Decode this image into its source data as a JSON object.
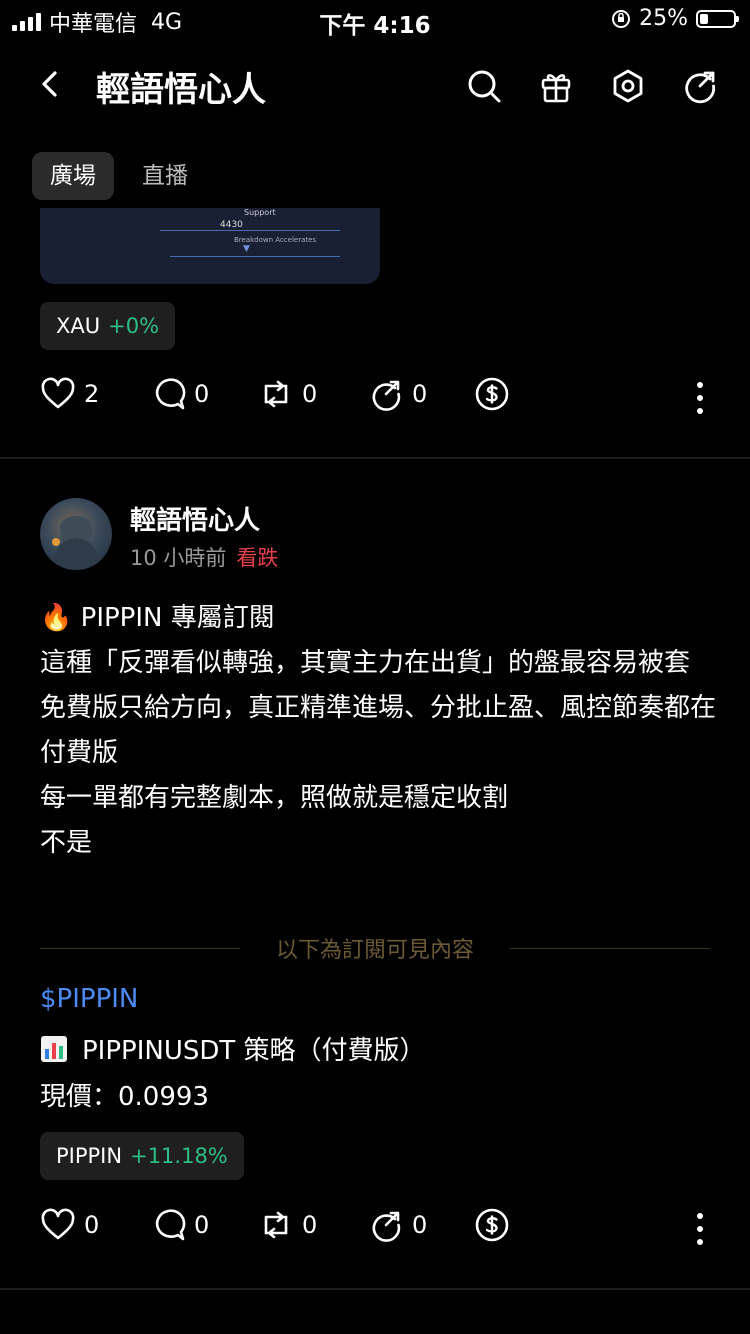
{
  "status_bar": {
    "carrier": "中華電信",
    "network": "4G",
    "time": "下午 4:16",
    "battery_percent": "25%",
    "battery_level": 0.25
  },
  "header": {
    "back_icon": "chevron-left-icon",
    "title": "輕語悟心人",
    "icons": [
      "search-icon",
      "gift-icon",
      "settings-hex-icon",
      "share-icon"
    ]
  },
  "tabs": [
    {
      "label": "廣場",
      "active": true
    },
    {
      "label": "直播",
      "active": false
    }
  ],
  "post1": {
    "image": {
      "label_support": "Support",
      "value": "4430",
      "label_breakdown": "Breakdown Accelerates"
    },
    "tag": {
      "symbol": "XAU",
      "change": "+0%"
    },
    "actions": {
      "likes": "2",
      "comments": "0",
      "reposts": "0",
      "quotes": "0"
    }
  },
  "post2": {
    "author": "輕語悟心人",
    "time_ago": "10 小時前",
    "sentiment": "看跌",
    "body_lines": [
      "🔥 PIPPIN 專屬訂閱",
      "這種「反彈看似轉強，其實主力在出貨」的盤最容易被套",
      "免費版只給方向，真正精準進場、分批止盈、風控節奏都在付費版",
      "每一單都有完整劇本，照做就是穩定收割",
      "不是"
    ],
    "paywall_text": "以下為訂閱可見內容",
    "ticker": "$PIPPIN",
    "strategy_icon": "bar-chart-icon",
    "strategy_title": "PIPPINUSDT 策略（付費版）",
    "price_line": "現價：0.0993",
    "tag": {
      "symbol": "PIPPIN",
      "change": "+11.18%"
    },
    "actions": {
      "likes": "0",
      "comments": "0",
      "reposts": "0",
      "quotes": "0"
    }
  },
  "colors": {
    "positive": "#2ebd85",
    "negative": "#e8414c",
    "link": "#4c8bf5",
    "paywall_text": "#6b5a34"
  }
}
